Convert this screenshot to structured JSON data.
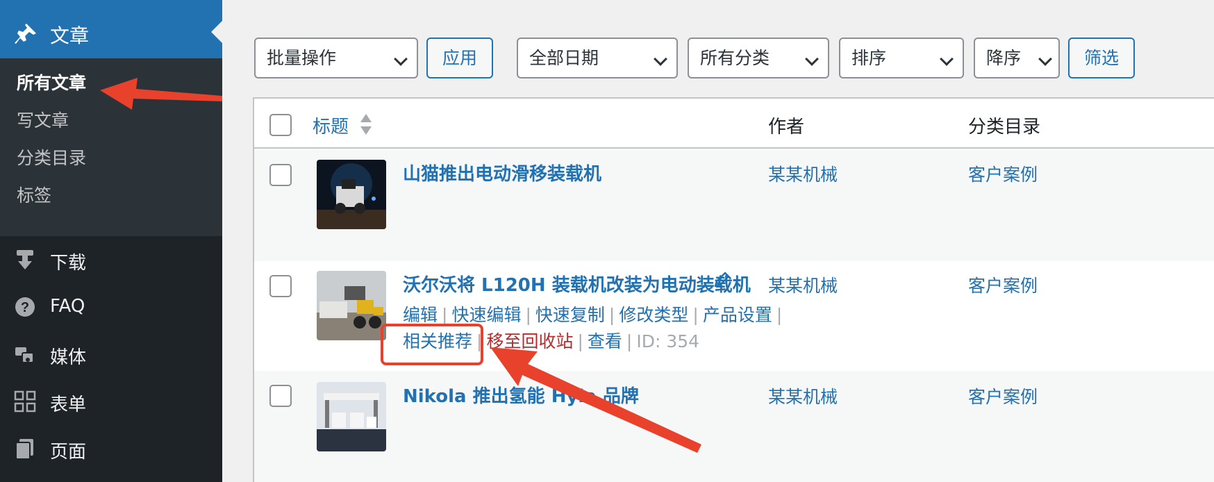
{
  "sidebar": {
    "active_menu": "文章",
    "submenu": [
      "所有文章",
      "写文章",
      "分类目录",
      "标签"
    ],
    "menu_items": [
      {
        "label": "下载",
        "icon": "download-icon"
      },
      {
        "label": "FAQ",
        "icon": "help-icon"
      },
      {
        "label": "媒体",
        "icon": "media-icon"
      },
      {
        "label": "表单",
        "icon": "forms-icon"
      },
      {
        "label": "页面",
        "icon": "pages-icon"
      }
    ]
  },
  "toolbar": {
    "bulk_actions": "批量操作",
    "apply": "应用",
    "dates": "全部日期",
    "categories": "所有分类",
    "sort": "排序",
    "order": "降序",
    "filter": "筛选"
  },
  "table": {
    "headers": {
      "title": "标题",
      "author": "作者",
      "category": "分类目录"
    },
    "rows": [
      {
        "title": "山猫推出电动滑移装载机",
        "author": "某某机械",
        "category": "客户案例"
      },
      {
        "title": "沃尔沃将 L120H 装载机改装为电动装载机",
        "author": "某某机械",
        "category": "客户案例",
        "actions": [
          "编辑",
          "快速编辑",
          "快速复制",
          "修改类型",
          "产品设置",
          "相关推荐",
          "移至回收站",
          "查看"
        ],
        "id_text": "ID: 354"
      },
      {
        "title": "Nikola 推出氢能 Hyla 品牌",
        "author": "某某机械",
        "category": "客户案例"
      }
    ]
  },
  "colors": {
    "accent": "#2271b1",
    "annotation": "#e8412c",
    "sidebar": "#1d2327",
    "trash": "#b32d2e"
  }
}
